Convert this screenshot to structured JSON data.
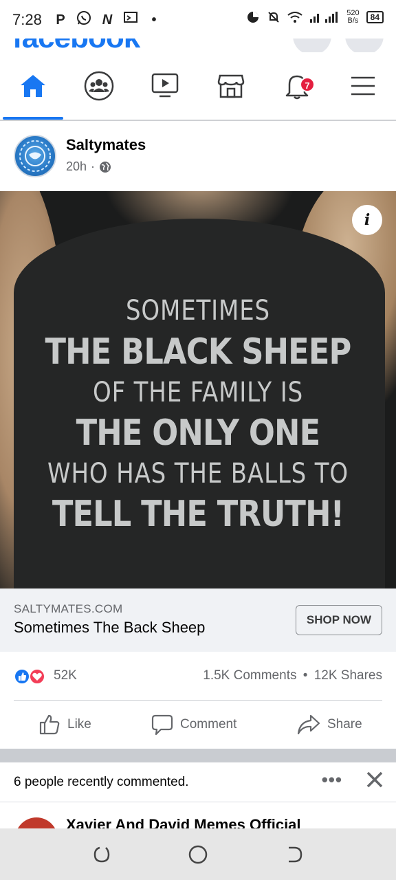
{
  "status_bar": {
    "time": "7:28",
    "left_icons": [
      "P",
      "whatsapp-icon",
      "N",
      "screen-icon",
      "•"
    ],
    "net_speed_value": "520",
    "net_speed_unit": "B/s",
    "battery": "84"
  },
  "header": {
    "logo": "facebook"
  },
  "nav": {
    "tabs": [
      {
        "name": "home",
        "icon": "home-icon",
        "active": true
      },
      {
        "name": "groups",
        "icon": "groups-icon",
        "active": false
      },
      {
        "name": "watch",
        "icon": "video-icon",
        "active": false
      },
      {
        "name": "marketplace",
        "icon": "marketplace-icon",
        "active": false
      },
      {
        "name": "notifications",
        "icon": "bell-icon",
        "active": false,
        "badge": "7"
      },
      {
        "name": "menu",
        "icon": "menu-icon",
        "active": false
      }
    ]
  },
  "post": {
    "page_name": "Saltymates",
    "time": "20h",
    "separator": "·",
    "image": {
      "text_lines": [
        "SOMETIMES",
        "THE BLACK SHEEP",
        "OF THE FAMILY IS",
        "THE ONLY ONE",
        "WHO HAS THE BALLS TO",
        "TELL THE TRUTH!"
      ],
      "info_label": "i"
    },
    "link": {
      "domain": "SALTYMATES.COM",
      "title": "Sometimes The Back Sheep",
      "cta": "SHOP NOW"
    },
    "reactions": {
      "count": "52K",
      "comments": "1.5K Comments",
      "dot": "•",
      "shares": "12K Shares"
    },
    "actions": {
      "like": "Like",
      "comment": "Comment",
      "share": "Share"
    }
  },
  "recent_comments": {
    "text": "6 people recently commented.",
    "more": "•••"
  },
  "next_post": {
    "page_name": "Xavier And David Memes Official"
  },
  "colors": {
    "brand": "#1877f2",
    "badge": "#e41e3f",
    "shirt": "#252626",
    "shirt_text": "#c7c9c9"
  }
}
